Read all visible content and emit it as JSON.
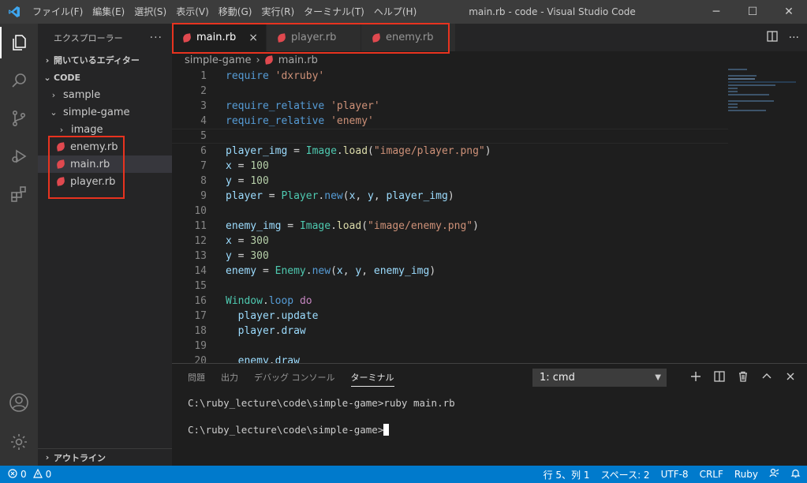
{
  "titlebar": {
    "menu": [
      "ファイル(F)",
      "編集(E)",
      "選択(S)",
      "表示(V)",
      "移動(G)",
      "実行(R)",
      "ターミナル(T)",
      "ヘルプ(H)"
    ],
    "title": "main.rb - code - Visual Studio Code",
    "minimize": "─",
    "maximize": "☐",
    "close": "✕"
  },
  "sidebar": {
    "header": "エクスプローラー",
    "more": "···",
    "open_editors": "開いているエディター",
    "root": "CODE",
    "tree": {
      "sample": "sample",
      "simple_game": "simple-game",
      "image": "image",
      "enemy": "enemy.rb",
      "main": "main.rb",
      "player": "player.rb"
    },
    "outline": "アウトライン"
  },
  "editor": {
    "tabs": [
      "main.rb",
      "player.rb",
      "enemy.rb"
    ],
    "tab_close": "×",
    "breadcrumb": {
      "folder": "simple-game",
      "file": "main.rb"
    },
    "line_numbers": [
      "1",
      "2",
      "3",
      "4",
      "5",
      "6",
      "7",
      "8",
      "9",
      "10",
      "11",
      "12",
      "13",
      "14",
      "15",
      "16",
      "17",
      "18",
      "19",
      "20"
    ],
    "lines": [
      "require 'dxruby'",
      "",
      "require_relative 'player'",
      "require_relative 'enemy'",
      "",
      "player_img = Image.load(\"image/player.png\")",
      "x = 100",
      "y = 100",
      "player = Player.new(x, y, player_img)",
      "",
      "enemy_img = Image.load(\"image/enemy.png\")",
      "x = 300",
      "y = 300",
      "enemy = Enemy.new(x, y, enemy_img)",
      "",
      "Window.loop do",
      "  player.update",
      "  player.draw",
      "",
      "  enemy.draw"
    ]
  },
  "panel": {
    "tabs": [
      "問題",
      "出力",
      "デバッグ コンソール",
      "ターミナル"
    ],
    "active_tab": "ターミナル",
    "terminal_select": "1: cmd",
    "terminal_lines": [
      "C:\\ruby_lecture\\code\\simple-game>ruby main.rb",
      "",
      "C:\\ruby_lecture\\code\\simple-game>"
    ]
  },
  "statusbar": {
    "errors": "0",
    "warnings": "0",
    "position": "行 5、列 1",
    "spaces": "スペース: 2",
    "encoding": "UTF-8",
    "eol": "CRLF",
    "language": "Ruby"
  },
  "colors": {
    "accent": "#007acc",
    "annotation": "#e8331f",
    "ruby_icon": "#e0494f"
  }
}
